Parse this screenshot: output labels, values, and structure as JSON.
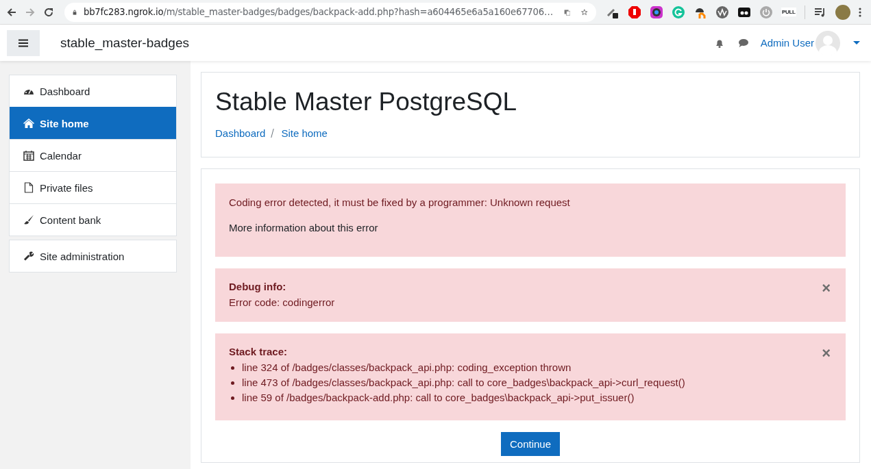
{
  "browser": {
    "url_host": "bb7fc283.ngrok.io",
    "url_path": "/m/stable_master-badges/badges/backpack-add.php?hash=a604465e6a5a160e67706…",
    "extension_label": "PULL"
  },
  "navbar": {
    "site_name": "stable_master-badges",
    "user_name": "Admin User"
  },
  "sidebar": {
    "groups": [
      {
        "items": [
          {
            "kind": "dashboard",
            "label": "Dashboard",
            "selected": false
          },
          {
            "kind": "home",
            "label": "Site home",
            "selected": true
          },
          {
            "kind": "calendar",
            "label": "Calendar",
            "selected": false
          },
          {
            "kind": "file",
            "label": "Private files",
            "selected": false
          },
          {
            "kind": "brush",
            "label": "Content bank",
            "selected": false
          }
        ]
      },
      {
        "items": [
          {
            "kind": "wrench",
            "label": "Site administration",
            "selected": false
          }
        ]
      }
    ]
  },
  "page_header": {
    "title": "Stable Master PostgreSQL",
    "breadcrumb": [
      "Dashboard",
      "Site home"
    ]
  },
  "error_message": {
    "text": "Coding error detected, it must be fixed by a programmer: Unknown request",
    "link": "More information about this error"
  },
  "alerts": [
    {
      "heading": "Debug info:",
      "lines": [
        "Error code: codingerror"
      ],
      "close": "×"
    },
    {
      "heading": "Stack trace:",
      "bullets": [
        "line 324 of /badges/classes/backpack_api.php: coding_exception thrown",
        "line 473 of /badges/classes/backpack_api.php: call to core_badges\\backpack_api->curl_request()",
        "line 59 of /badges/backpack-add.php: call to core_badges\\backpack_api->put_issuer()"
      ],
      "close": "×"
    }
  ],
  "continue_button": "Continue"
}
